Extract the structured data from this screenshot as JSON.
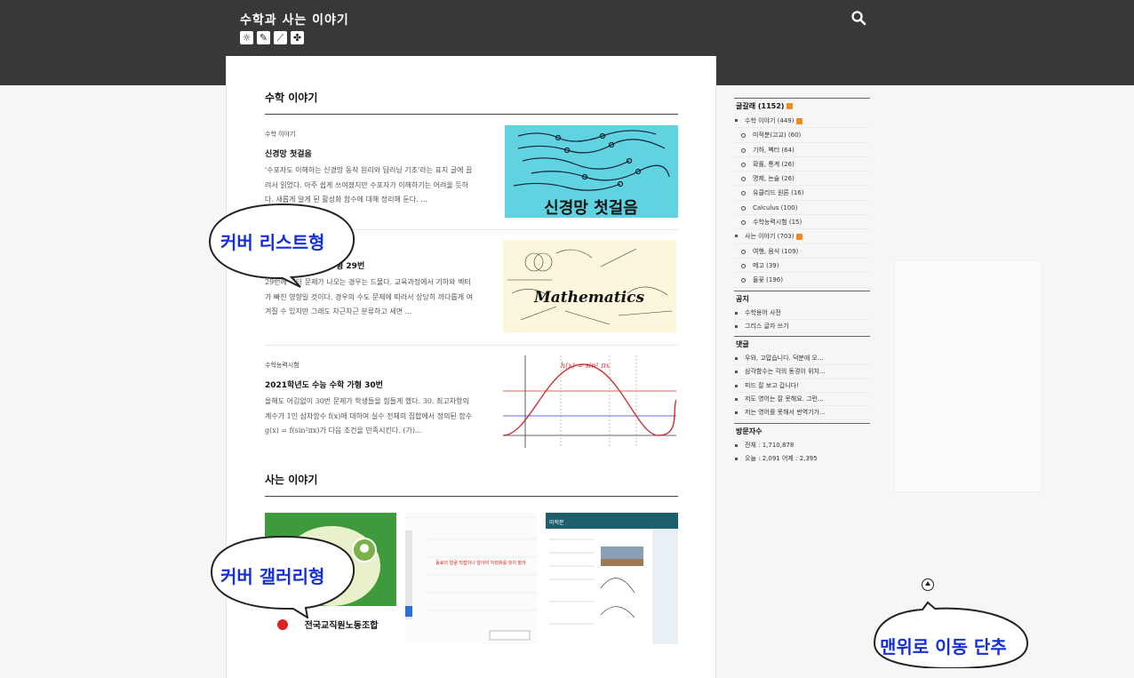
{
  "header": {
    "blog_title": "수학과 사는 이야기",
    "icons": [
      "sun-icon",
      "pencil-icon",
      "ruler-icon",
      "paw-icon"
    ],
    "search_icon": "search-icon"
  },
  "sections": [
    {
      "title": "수학 이야기",
      "posts": [
        {
          "category": "수학 이야기",
          "title": "신경망 첫걸음",
          "excerpt": "'수포자도 이해하는 신경망 동작 원리와 딥러닝 기초'라는 표지 글에 끌려서 읽었다. 아주 쉽게 쓰여졌지만 수포자가 이해하기는 어려울 듯하다. 새롭게 알게 된 활성화 함수에 대해 정리해 둔다. ...",
          "thumb_text": "신경망 첫걸음"
        },
        {
          "category": "",
          "title": "",
          "title_tail": "형 29번",
          "excerpt": "29번에 벡터 문제가 나오는 경우는 드물다. 교육과정에서 기하와 벡터가 빠진 영향일 것이다. 경우의 수도 문제에 따라서 상당히 까다롭게 여겨질 수 있지만 그래도 차근차근 분류하고 세면 ...",
          "thumb_text": "Mathematics"
        },
        {
          "category": "수학능력시험",
          "title": "2021학년도 수능 수학 가형 30번",
          "excerpt": "올해도 어김없이 30번 문제가 학생들을 힘들게 했다. 30. 최고차항의 계수가 1인 삼차함수 f(x)에 대하여 실수 전체의 집합에서 정의된 함수 g(x) = f(sin²πx)가 다음 조건을 만족시킨다. (가)...",
          "thumb_text": "h(x) = sin² πx"
        }
      ]
    },
    {
      "title": "사는 이야기",
      "gallery": [
        {
          "thumb_text": "전국교직원노동조합"
        },
        {
          "thumb_text": "동료의 얼굴 직접이나 알아야 지점화를 잊지 말라"
        },
        {
          "thumb_text": "미적분"
        }
      ]
    }
  ],
  "sidebar": {
    "category_head": "글갈래 (1152)",
    "categories": [
      {
        "label": "수학 이야기 (449)",
        "level": 1,
        "rss": true
      },
      {
        "label": "미적분(고교) (60)",
        "level": 2
      },
      {
        "label": "기하, 벡터 (64)",
        "level": 2
      },
      {
        "label": "확률, 통계 (26)",
        "level": 2
      },
      {
        "label": "명제, 논술 (26)",
        "level": 2
      },
      {
        "label": "유클리드 원론 (16)",
        "level": 2
      },
      {
        "label": "Calculus (100)",
        "level": 2
      },
      {
        "label": "수학능력시험 (15)",
        "level": 2
      },
      {
        "label": "사는 이야기 (703)",
        "level": 1,
        "rss": true
      },
      {
        "label": "여행, 음식 (109)",
        "level": 2
      },
      {
        "label": "메고 (39)",
        "level": 2
      },
      {
        "label": "들꽃 (196)",
        "level": 2
      }
    ],
    "notice_head": "공지",
    "notices": [
      "수학용어 사전",
      "그리스 글자 쓰기"
    ],
    "comment_head": "댓글",
    "comments": [
      "우와, 고맙습니다. 덕분에 오...",
      "삼각함수는 각의 동경이 위치...",
      "피드 잘 보고 갑니다!",
      "저도 영어는 잘 못해요. 그런...",
      "저는 영어를 못해서 번역기가..."
    ],
    "visitor_head": "방문자수",
    "visitor_total": "전체 : 1,710,878",
    "visitor_today": "오늘 : 2,091    어제 : 2,395"
  },
  "annotations": {
    "cover_list": "커버 리스트형",
    "cover_gallery": "커버 갤러리형",
    "back_to_top": "맨위로 이동 단추"
  },
  "colors": {
    "header_bg": "#383838",
    "annotation_text": "#1530d8",
    "rss": "#f08a24"
  }
}
